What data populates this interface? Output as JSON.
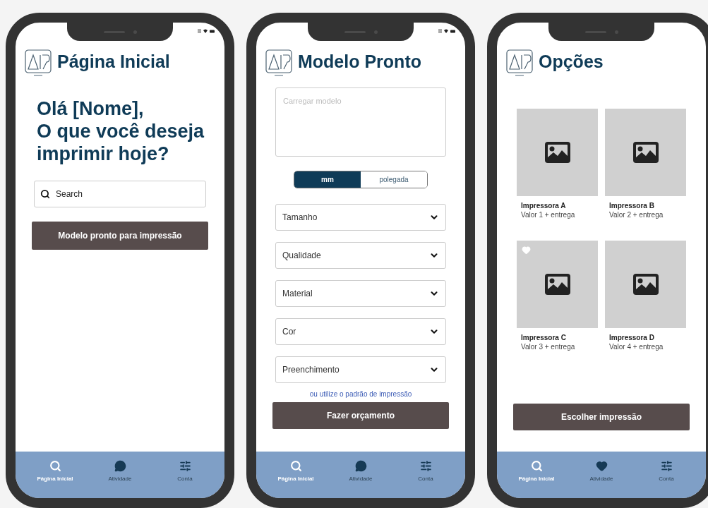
{
  "screens": [
    {
      "kind": "home",
      "title": "Página Inicial",
      "status_icons": true,
      "greeting": [
        "Olá [Nome],",
        "O que você deseja",
        "imprimir hoje?"
      ],
      "search": {
        "placeholder": "Search"
      },
      "button": "Modelo pronto para impressão",
      "nav": [
        {
          "label": "Página Inicial",
          "kind": "search",
          "selected": true
        },
        {
          "label": "Atividade",
          "kind": "chat",
          "selected": false
        },
        {
          "label": "Conta",
          "kind": "sliders",
          "selected": false
        }
      ]
    },
    {
      "kind": "model",
      "title": "Modelo Pronto",
      "status_icons": true,
      "upload": {
        "placeholder": "Carregar modelo"
      },
      "units": [
        {
          "label": "mm",
          "selected": true
        },
        {
          "label": "polegada",
          "selected": false
        }
      ],
      "selects": [
        "Tamanho",
        "Qualidade",
        "Material",
        "Cor",
        "Preenchimento"
      ],
      "link": "ou utilize o padrão de impressão",
      "button": "Fazer orçamento",
      "nav": [
        {
          "label": "Página Inicial",
          "kind": "search",
          "selected": true
        },
        {
          "label": "Atividade",
          "kind": "chat",
          "selected": false
        },
        {
          "label": "Conta",
          "kind": "sliders",
          "selected": false
        }
      ]
    },
    {
      "kind": "options",
      "title": "Opções",
      "status_icons": false,
      "products": [
        {
          "name": "Impressora A",
          "price": "Valor 1 + entrega",
          "favorite": false
        },
        {
          "name": "Impressora B",
          "price": "Valor 2 + entrega",
          "favorite": false
        },
        {
          "name": "Impressora C",
          "price": "Valor 3 + entrega",
          "favorite": true
        },
        {
          "name": "Impressora D",
          "price": "Valor 4 + entrega",
          "favorite": false
        }
      ],
      "button": "Escolher impressão",
      "nav": [
        {
          "label": "Página Inicial",
          "kind": "search",
          "selected": true
        },
        {
          "label": "Atividade",
          "kind": "heart",
          "selected": false
        },
        {
          "label": "Conta",
          "kind": "sliders",
          "selected": false
        }
      ]
    }
  ]
}
